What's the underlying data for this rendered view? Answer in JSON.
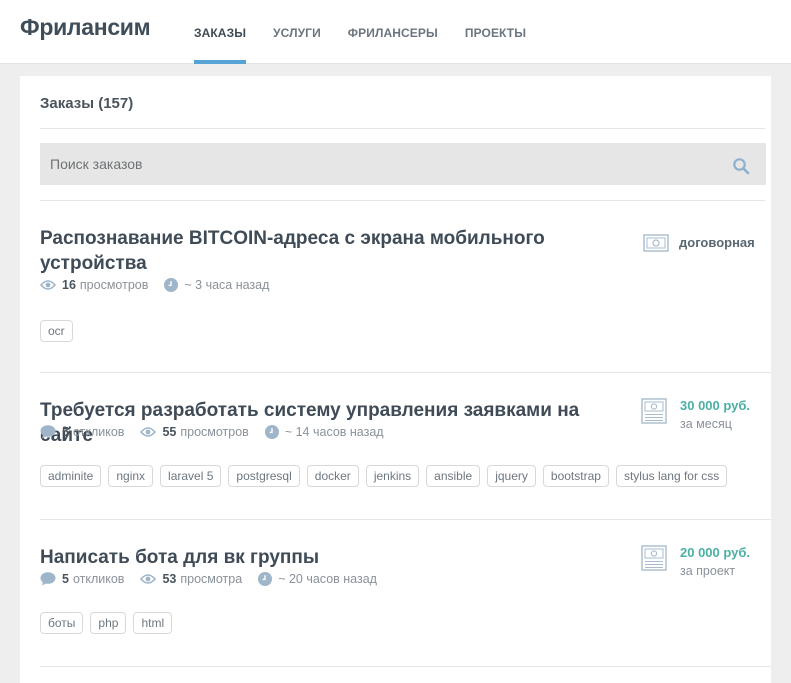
{
  "header": {
    "logo": "Фрилансим",
    "nav": [
      "ЗАКАЗЫ",
      "УСЛУГИ",
      "ФРИЛАНСЕРЫ",
      "ПРОЕКТЫ"
    ]
  },
  "page": {
    "heading": "Заказы (157)",
    "search_placeholder": "Поиск заказов"
  },
  "orders": [
    {
      "title": "Распознавание BITCOIN-адреса с экрана мобильного устройства",
      "responses": null,
      "views": "16",
      "views_label": "просмотров",
      "time": "~ 3 часа назад",
      "price": "договорная",
      "period": "",
      "tags": [
        "ocr"
      ]
    },
    {
      "title": "Требуется разработать систему управления заявками на сайте",
      "responses": "5",
      "responses_label": "откликов",
      "views": "55",
      "views_label": "просмотров",
      "time": "~ 14 часов назад",
      "price": "30 000 руб.",
      "period": "за месяц",
      "tags": [
        "adminite",
        "nginx",
        "laravel 5",
        "postgresql",
        "docker",
        "jenkins",
        "ansible",
        "jquery",
        "bootstrap",
        "stylus lang for css"
      ]
    },
    {
      "title": "Написать бота для вк группы",
      "responses": "5",
      "responses_label": "откликов",
      "views": "53",
      "views_label": "просмотра",
      "time": "~ 20 часов назад",
      "price": "20 000 руб.",
      "period": "за проект",
      "tags": [
        "боты",
        "php",
        "html"
      ]
    }
  ],
  "colors": {
    "accent": "#56a3d5",
    "price_green": "#4bb0a4",
    "icon": "#9fb5c9"
  }
}
